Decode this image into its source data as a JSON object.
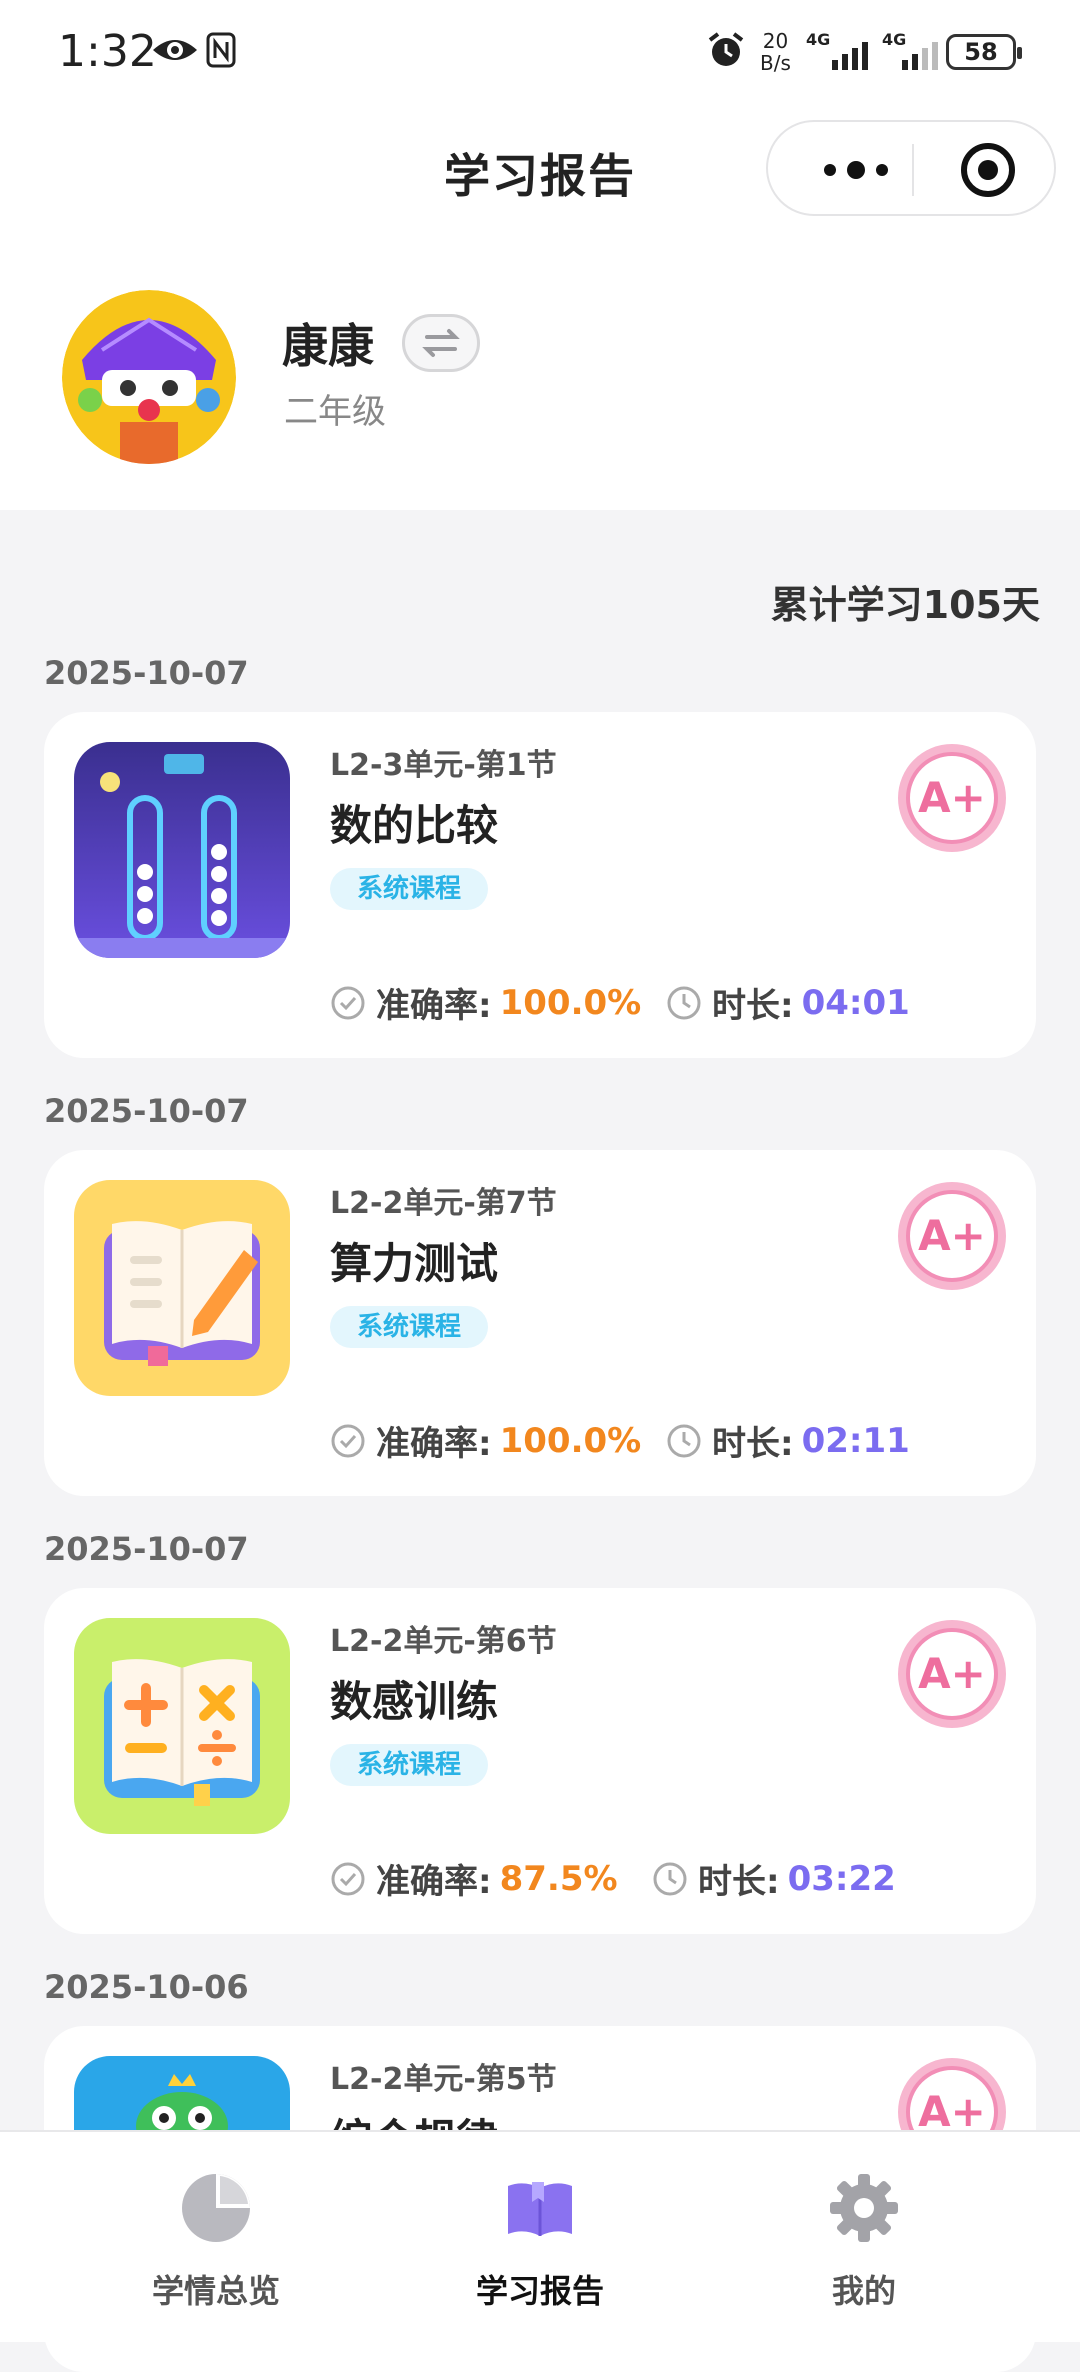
{
  "status_bar": {
    "time": "1:32",
    "net_speed_value": "20",
    "net_speed_unit": "B/s",
    "signal_1": "4G",
    "signal_2": "4G",
    "battery": "58"
  },
  "header": {
    "title": "学习报告"
  },
  "profile": {
    "name": "康康",
    "grade": "二年级"
  },
  "summary": {
    "cumulative": "累计学习105天"
  },
  "labels": {
    "accuracy": "准确率:",
    "duration": "时长:",
    "badge": "A+"
  },
  "reports": [
    {
      "date": "2025-10-07",
      "lesson": "L2-3单元-第1节",
      "title": "数的比较",
      "tag": "系统课程",
      "accuracy": "100.0%",
      "duration": "04:01"
    },
    {
      "date": "2025-10-07",
      "lesson": "L2-2单元-第7节",
      "title": "算力测试",
      "tag": "系统课程",
      "accuracy": "100.0%",
      "duration": "02:11"
    },
    {
      "date": "2025-10-07",
      "lesson": "L2-2单元-第6节",
      "title": "数感训练",
      "tag": "系统课程",
      "accuracy": "87.5%",
      "duration": "03:22"
    },
    {
      "date": "2025-10-06",
      "lesson": "L2-2单元-第5节",
      "title": "综合规律"
    }
  ],
  "nav": {
    "items": [
      {
        "label": "学情总览",
        "icon": "pie-chart-icon"
      },
      {
        "label": "学习报告",
        "icon": "book-icon",
        "active": true
      },
      {
        "label": "我的",
        "icon": "gear-icon"
      }
    ]
  },
  "colors": {
    "accent_orange": "#f2871e",
    "accent_purple": "#7b6cf0",
    "tag_blue": "#2ab3e6",
    "badge_pink": "#f07aa8"
  }
}
